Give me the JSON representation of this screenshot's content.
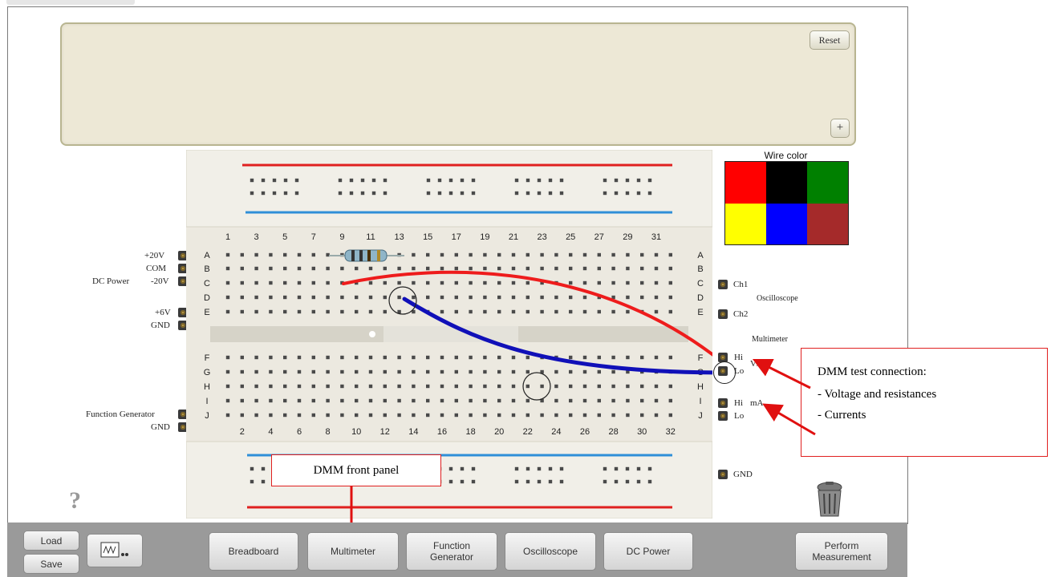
{
  "panel": {
    "reset_label": "Reset",
    "plus_label": "+"
  },
  "power_labels": {
    "p20v": "+20V",
    "com": "COM",
    "m20v": "-20V",
    "dc_power": "DC Power",
    "p6v": "+6V",
    "gnd": "GND"
  },
  "fg_labels": {
    "fg": "Function Generator",
    "gnd": "GND"
  },
  "right_labels": {
    "ch1": "Ch1",
    "ch2": "Ch2",
    "oscilloscope": "Oscilloscope",
    "multimeter": "Multimeter",
    "hi1": "Hi",
    "vo": "V/Ω",
    "lo1": "Lo",
    "hi2": "Hi",
    "ma": "mA",
    "lo2": "Lo",
    "gnd": "GND"
  },
  "breadboard": {
    "top_numbers": [
      "1",
      "3",
      "5",
      "7",
      "9",
      "11",
      "13",
      "15",
      "17",
      "19",
      "21",
      "23",
      "25",
      "27",
      "29",
      "31"
    ],
    "bottom_numbers": [
      "2",
      "4",
      "6",
      "8",
      "10",
      "12",
      "14",
      "16",
      "18",
      "20",
      "22",
      "24",
      "26",
      "28",
      "30",
      "32"
    ],
    "upper_rows": [
      "A",
      "B",
      "C",
      "D",
      "E"
    ],
    "lower_rows": [
      "F",
      "G",
      "H",
      "I",
      "J"
    ]
  },
  "wire_color": {
    "title": "Wire color",
    "colors": [
      "#ff0000",
      "#000000",
      "#008000",
      "#ffff00",
      "#0000ff",
      "#a52a2a"
    ]
  },
  "callouts": {
    "dmm_title": "DMM test connection:",
    "dmm_line1": "- Voltage and resistances",
    "dmm_line2": "- Currents",
    "front_panel": "DMM front panel"
  },
  "toolbar": {
    "load": "Load",
    "save": "Save",
    "breadboard": "Breadboard",
    "multimeter": "Multimeter",
    "function_generator": "Function\nGenerator",
    "oscilloscope": "Oscilloscope",
    "dc_power": "DC Power",
    "perform": "Perform\nMeasurement"
  },
  "help_label": "?"
}
